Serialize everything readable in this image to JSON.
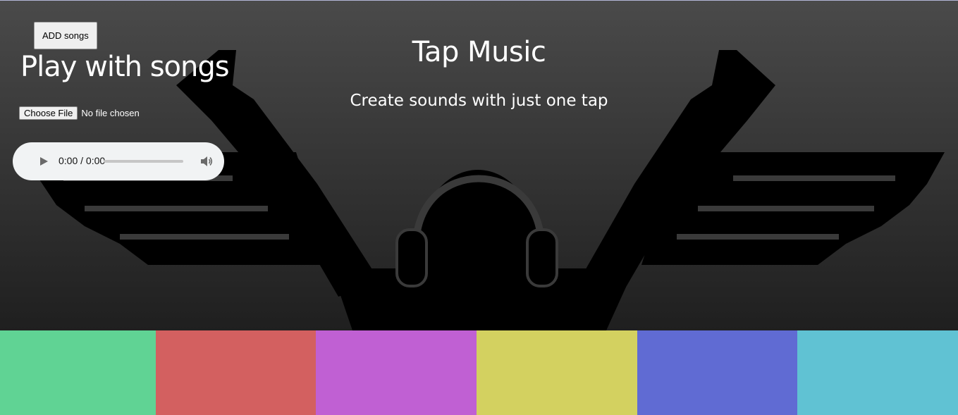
{
  "header": {
    "add_songs_label": "ADD songs",
    "play_title": "Play with songs",
    "app_title": "Tap Music",
    "subtitle": "Create sounds with just one tap"
  },
  "file_input": {
    "button_label": "Choose File",
    "status": "No file chosen"
  },
  "audio_player": {
    "time": "0:00 / 0:00",
    "icons": [
      "play-icon",
      "volume-icon"
    ]
  },
  "pads": [
    {
      "name": "pad-1",
      "color": "#60d394"
    },
    {
      "name": "pad-2",
      "color": "#d36060"
    },
    {
      "name": "pad-3",
      "color": "#c060d3"
    },
    {
      "name": "pad-4",
      "color": "#d3d160"
    },
    {
      "name": "pad-5",
      "color": "#606bd3"
    },
    {
      "name": "pad-6",
      "color": "#60c2d3"
    }
  ]
}
